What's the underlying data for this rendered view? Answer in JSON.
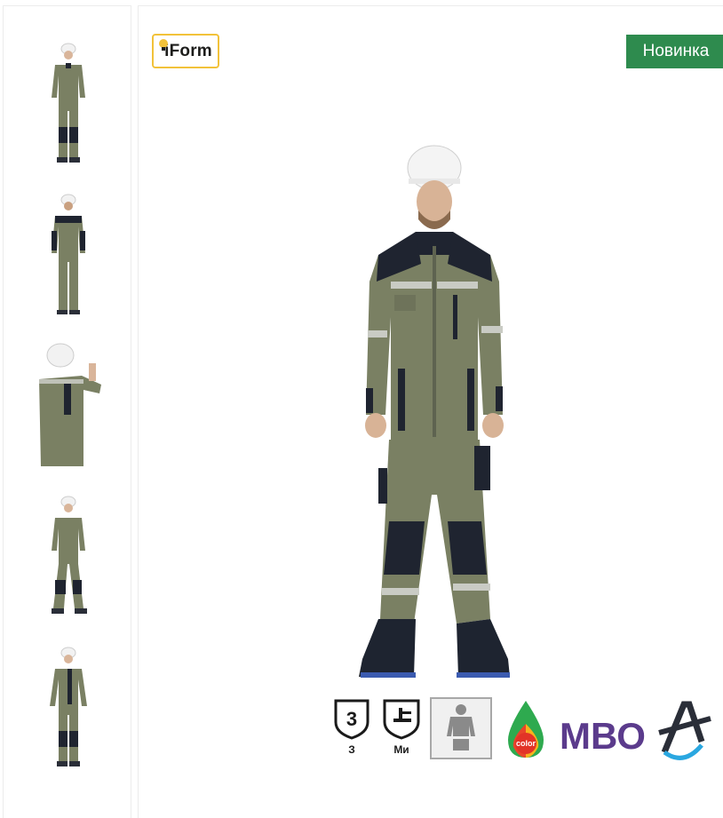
{
  "brand": {
    "logo_text": "iForm"
  },
  "badge": {
    "label": "Новинка"
  },
  "thumbnails": [
    {
      "view": "front"
    },
    {
      "view": "back"
    },
    {
      "view": "side-raised-arm"
    },
    {
      "view": "walking"
    },
    {
      "view": "three-quarter"
    }
  ],
  "certifications": [
    {
      "icon": "protection-class-3-icon",
      "symbol": "3",
      "label": "З"
    },
    {
      "icon": "mechanical-protection-icon",
      "label": "Ми"
    },
    {
      "icon": "body-protection-icon"
    },
    {
      "icon": "color-tech-icon",
      "text": "color"
    },
    {
      "icon": "mbo-icon",
      "text": "МВО"
    }
  ],
  "colors": {
    "badge": "#2e8b4e",
    "brand_border": "#f2c23a",
    "suit": "#7a8063",
    "suit_dark": "#1f2430"
  }
}
